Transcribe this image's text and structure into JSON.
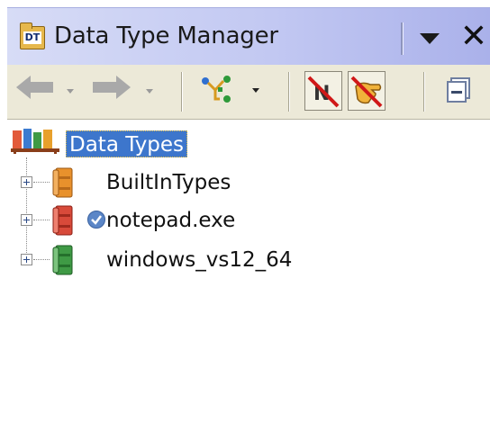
{
  "window": {
    "title": "Data Type Manager",
    "title_icon_text": "DT",
    "menu_icon": "dropdown-triangle-icon",
    "close_label": "✕"
  },
  "toolbar": {
    "back_icon": "arrow-left-icon",
    "forward_icon": "arrow-right-icon",
    "merge_icon": "merge-datatypes-icon",
    "filter_arrays_icon": "filter-arrays-icon",
    "filter_pointers_icon": "filter-pointers-icon",
    "collapse_icon": "collapse-all-icon"
  },
  "tree": {
    "root": {
      "label": "Data Types",
      "icon": "bookshelf-icon",
      "selected": true
    },
    "items": [
      {
        "label": "BuiltInTypes",
        "icon": "book-orange-icon",
        "color": "#e8912c"
      },
      {
        "label": "notepad.exe",
        "icon": "book-red-icon",
        "color": "#d84a3a",
        "status_icon": "check-circle-icon"
      },
      {
        "label": "windows_vs12_64",
        "icon": "book-green-icon",
        "color": "#3f9a45"
      }
    ]
  },
  "colors": {
    "title_gradient_start": "#d7dcf6",
    "title_gradient_end": "#aab1ea",
    "toolbar_bg": "#ece9d8",
    "selection": "#3d76cc"
  }
}
